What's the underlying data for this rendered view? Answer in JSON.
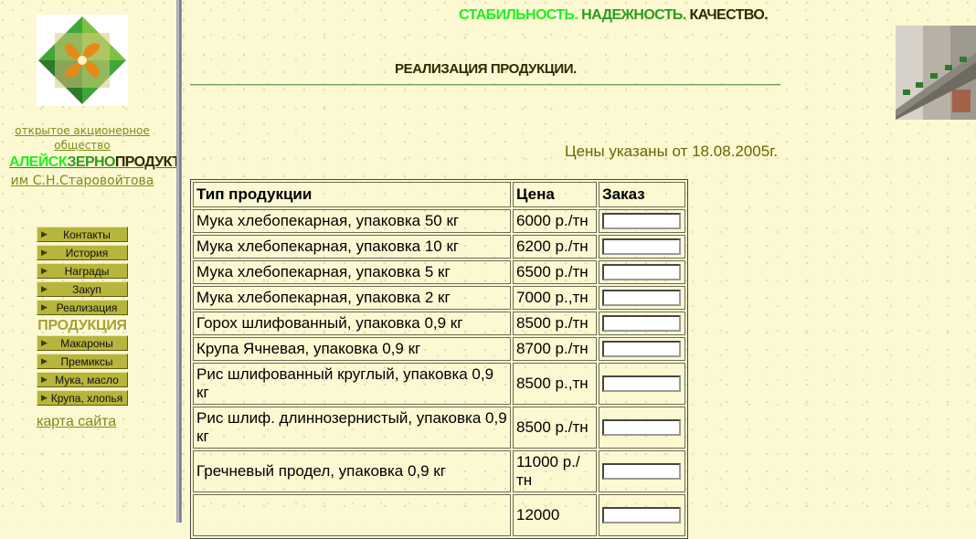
{
  "slogan": {
    "part1": "СТАБИЛЬНОСТЬ.",
    "part2": "НАДЕЖНОСТЬ.",
    "part3": "КАЧЕСТВО."
  },
  "sidebar": {
    "company_type": "открытое акционерное общество",
    "company_name_part1": "АЛЕЙСК",
    "company_name_part2": "ЗЕРНО",
    "company_name_part3": "ПРОДУКТ",
    "company_im": "им С.Н.Старовойтова",
    "nav_main": [
      {
        "label": "Контакты",
        "name": "nav-item-contacts"
      },
      {
        "label": "История",
        "name": "nav-item-history"
      },
      {
        "label": "Награды",
        "name": "nav-item-awards"
      },
      {
        "label": "Закуп",
        "name": "nav-item-purchase"
      },
      {
        "label": "Реализация",
        "name": "nav-item-sales"
      }
    ],
    "products_heading": "ПРОДУКЦИЯ",
    "nav_products": [
      {
        "label": "Макароны",
        "name": "nav-item-pasta"
      },
      {
        "label": "Премиксы",
        "name": "nav-item-premixes"
      },
      {
        "label": "Мука, масло",
        "name": "nav-item-flour-oil"
      },
      {
        "label": "Крупа, хлопья",
        "name": "nav-item-cereals-flakes"
      }
    ],
    "sitemap_link": "карта сайта"
  },
  "main": {
    "page_title": "РЕАЛИЗАЦИЯ ПРОДУКЦИИ.",
    "price_note": "Цены указаны от 18.08.2005г.",
    "table": {
      "headers": [
        "Тип продукции",
        "Цена",
        "Заказ"
      ],
      "rows": [
        {
          "name": "Мука хлебопекарная, упаковка 50 кг",
          "price": "6000 р./тн"
        },
        {
          "name": "Мука хлебопекарная, упаковка 10 кг",
          "price": "6200 р./тн"
        },
        {
          "name": "Мука хлебопекарная, упаковка 5 кг",
          "price": "6500 р./тн"
        },
        {
          "name": "Мука хлебопекарная, упаковка 2 кг",
          "price": "7000 р.,тн"
        },
        {
          "name": "Горох шлифованный, упаковка 0,9 кг",
          "price": "8500 р./тн"
        },
        {
          "name": "Крупа Ячневая, упаковка 0,9 кг",
          "price": "8700 р./тн"
        },
        {
          "name": "Рис шлифованный круглый, упаковка 0,9 кг",
          "price": "8500 р.,тн"
        },
        {
          "name": "Рис шлиф. длиннозернистый, упаковка 0,9 кг",
          "price": "8500 р./тн"
        },
        {
          "name": "Гречневый продел, упаковка 0,9 кг",
          "price": "11000 р./тн"
        },
        {
          "name": "",
          "price": "12000"
        }
      ]
    }
  }
}
